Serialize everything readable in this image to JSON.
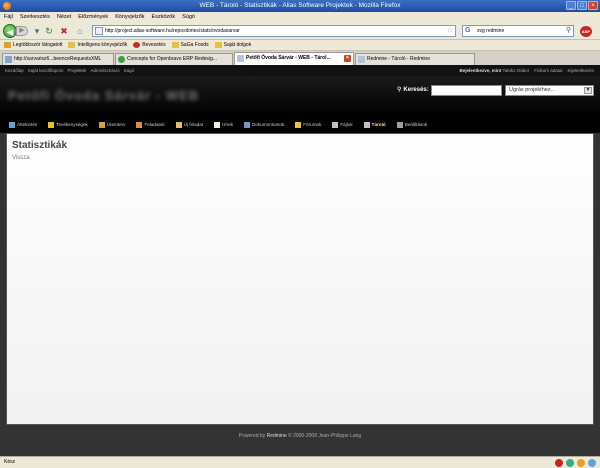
{
  "window": {
    "title": "WEB - Tároló - Statisztikák - Alias Software Projektek - Mozilla Firefox",
    "controls": [
      "_",
      "□",
      "×"
    ]
  },
  "menubar": [
    "Fájl",
    "Szerkesztés",
    "Nézet",
    "Előzmények",
    "Könyvjelzők",
    "Eszközök",
    "Súgó"
  ],
  "navbar": {
    "url": "http://project.alias-software.hu/repositories/stats/ovodasarvar",
    "search_value": "svg redmine",
    "adblock_label": "ABP"
  },
  "bookmarks": [
    {
      "label": "Legtöbbször látogatott",
      "color": "#e8a020"
    },
    {
      "label": "Intelligens könyvjelzők",
      "color": "#e8c040"
    },
    {
      "label": "Bevezetés",
      "color": "#c03020"
    },
    {
      "label": "SaGa Foods",
      "color": "#e8c040"
    },
    {
      "label": "Saját dolgok",
      "color": "#e8c040"
    }
  ],
  "tabs": [
    {
      "label": "http://sarvarisz6...beenceRequestsXML",
      "active": false,
      "icon_color": "#8aa4c8"
    },
    {
      "label": "Concepts for Openbravo ERP Redesig...",
      "active": false,
      "icon_color": "#3aa23a"
    },
    {
      "label": "Petőfi Óvoda Sárvár - WEB - Tárol...",
      "active": true,
      "icon_color": "#b0c4de"
    },
    {
      "label": "Redmine - Tároló - Redmine",
      "active": false,
      "icon_color": "#b0c4de"
    }
  ],
  "topmenu": {
    "left": [
      "Kezdőlap",
      "Saját kezdőlapom",
      "Projektek",
      "Adminisztráció",
      "Súgó"
    ],
    "logged_prefix": "Bejelentkezve, mint",
    "logged_user": "Tabiko Gábor",
    "right": [
      "Fiókom adatai",
      "Kijelentkezés"
    ]
  },
  "header": {
    "project_title": "Petőfi Óvoda Sárvár - WEB",
    "search_label": "Keresés:",
    "search_value": "",
    "jump_placeholder": "Ugrás projekthez..."
  },
  "mainmenu": [
    {
      "label": "Áttekintés",
      "icon_color": "#6aa0d8",
      "selected": false
    },
    {
      "label": "Tevékenységek",
      "icon_color": "#f0c020",
      "selected": false
    },
    {
      "label": "Ütemterv",
      "icon_color": "#d8a040",
      "selected": false
    },
    {
      "label": "Feladatok",
      "icon_color": "#d89050",
      "selected": false
    },
    {
      "label": "Új feladat",
      "icon_color": "#e0c070",
      "selected": false
    },
    {
      "label": "Hírek",
      "icon_color": "#f0f0e0",
      "selected": false
    },
    {
      "label": "Dokumentumok",
      "icon_color": "#8090c0",
      "selected": false
    },
    {
      "label": "Fórumok",
      "icon_color": "#f0c030",
      "selected": false
    },
    {
      "label": "Fájlok",
      "icon_color": "#c0c0c0",
      "selected": false
    },
    {
      "label": "Tároló",
      "icon_color": "#c0c0c0",
      "selected": true
    },
    {
      "label": "Beállítások",
      "icon_color": "#a0a0a0",
      "selected": false
    }
  ],
  "content": {
    "title": "Statisztikák",
    "back_link": "Vissza"
  },
  "footer": {
    "prefix": "Powered by",
    "brand": "Redmine",
    "suffix": "© 2006-2008 Jean-Philippe Lang"
  },
  "statusbar": {
    "text": "Kész"
  }
}
